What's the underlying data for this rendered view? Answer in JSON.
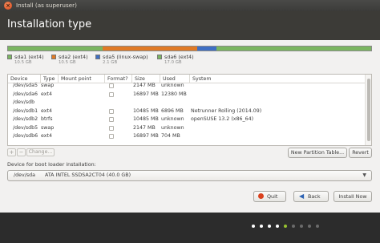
{
  "window": {
    "title": "Install (as superuser)",
    "close_glyph": "×"
  },
  "header": {
    "title": "Installation type"
  },
  "partition_bar": {
    "segments": [
      {
        "fraction": 0.26,
        "color": "#7bb661"
      },
      {
        "fraction": 0.26,
        "color": "#e07a26"
      },
      {
        "fraction": 0.055,
        "color": "#3f6fc4"
      },
      {
        "fraction": 0.425,
        "color": "#7bb661"
      }
    ]
  },
  "legend": [
    {
      "label": "sda1 (ext4)",
      "size": "10.5 GB",
      "color": "#7bb661"
    },
    {
      "label": "sda2 (ext4)",
      "size": "10.5 GB",
      "color": "#e07a26"
    },
    {
      "label": "sda5 (linux-swap)",
      "size": "2.1 GB",
      "color": "#3f6fc4"
    },
    {
      "label": "sda6 (ext4)",
      "size": "17.0 GB",
      "color": "#7bb661"
    }
  ],
  "table": {
    "columns": [
      "Device",
      "Type",
      "Mount point",
      "Format?",
      "Size",
      "Used",
      "System"
    ],
    "rows": [
      {
        "device": "/dev/sda5",
        "type": "swap",
        "mount": "",
        "format": true,
        "size": "2147 MB",
        "used": "unknown",
        "system": ""
      },
      {
        "device": "/dev/sda6",
        "type": "ext4",
        "mount": "",
        "format": true,
        "size": "16897 MB",
        "used": "12380 MB",
        "system": ""
      },
      {
        "device": "/dev/sdb",
        "type": "",
        "mount": "",
        "format": false,
        "size": "",
        "used": "",
        "system": ""
      },
      {
        "device": "/dev/sdb1",
        "type": "ext4",
        "mount": "",
        "format": true,
        "size": "10485 MB",
        "used": "6896 MB",
        "system": "Netrunner Rolling (2014.09)"
      },
      {
        "device": "/dev/sdb2",
        "type": "btrfs",
        "mount": "",
        "format": true,
        "size": "10485 MB",
        "used": "unknown",
        "system": "openSUSE 13.2 (x86_64)"
      },
      {
        "device": "/dev/sdb5",
        "type": "swap",
        "mount": "",
        "format": true,
        "size": "2147 MB",
        "used": "unknown",
        "system": ""
      },
      {
        "device": "/dev/sdb6",
        "type": "ext4",
        "mount": "",
        "format": true,
        "size": "16897 MB",
        "used": "704 MB",
        "system": ""
      }
    ]
  },
  "toolbar": {
    "add_label": "+",
    "remove_label": "−",
    "change_label": "Change...",
    "new_table_label": "New Partition Table...",
    "revert_label": "Revert"
  },
  "bootloader": {
    "label": "Device for boot loader installation:",
    "device": "/dev/sda",
    "description": "ATA INTEL SSDSA2CT04 (40.0 GB)",
    "arrow_glyph": "▼"
  },
  "actions": {
    "quit_label": "Quit",
    "back_label": "Back",
    "back_glyph": "◀",
    "install_label": "Install Now"
  },
  "progress": {
    "step_count": 9,
    "completed_steps": 4,
    "current_step": 5,
    "done_color": "#ffffff",
    "current_color": "#97c230",
    "todo_color": "#6b6b6b"
  }
}
